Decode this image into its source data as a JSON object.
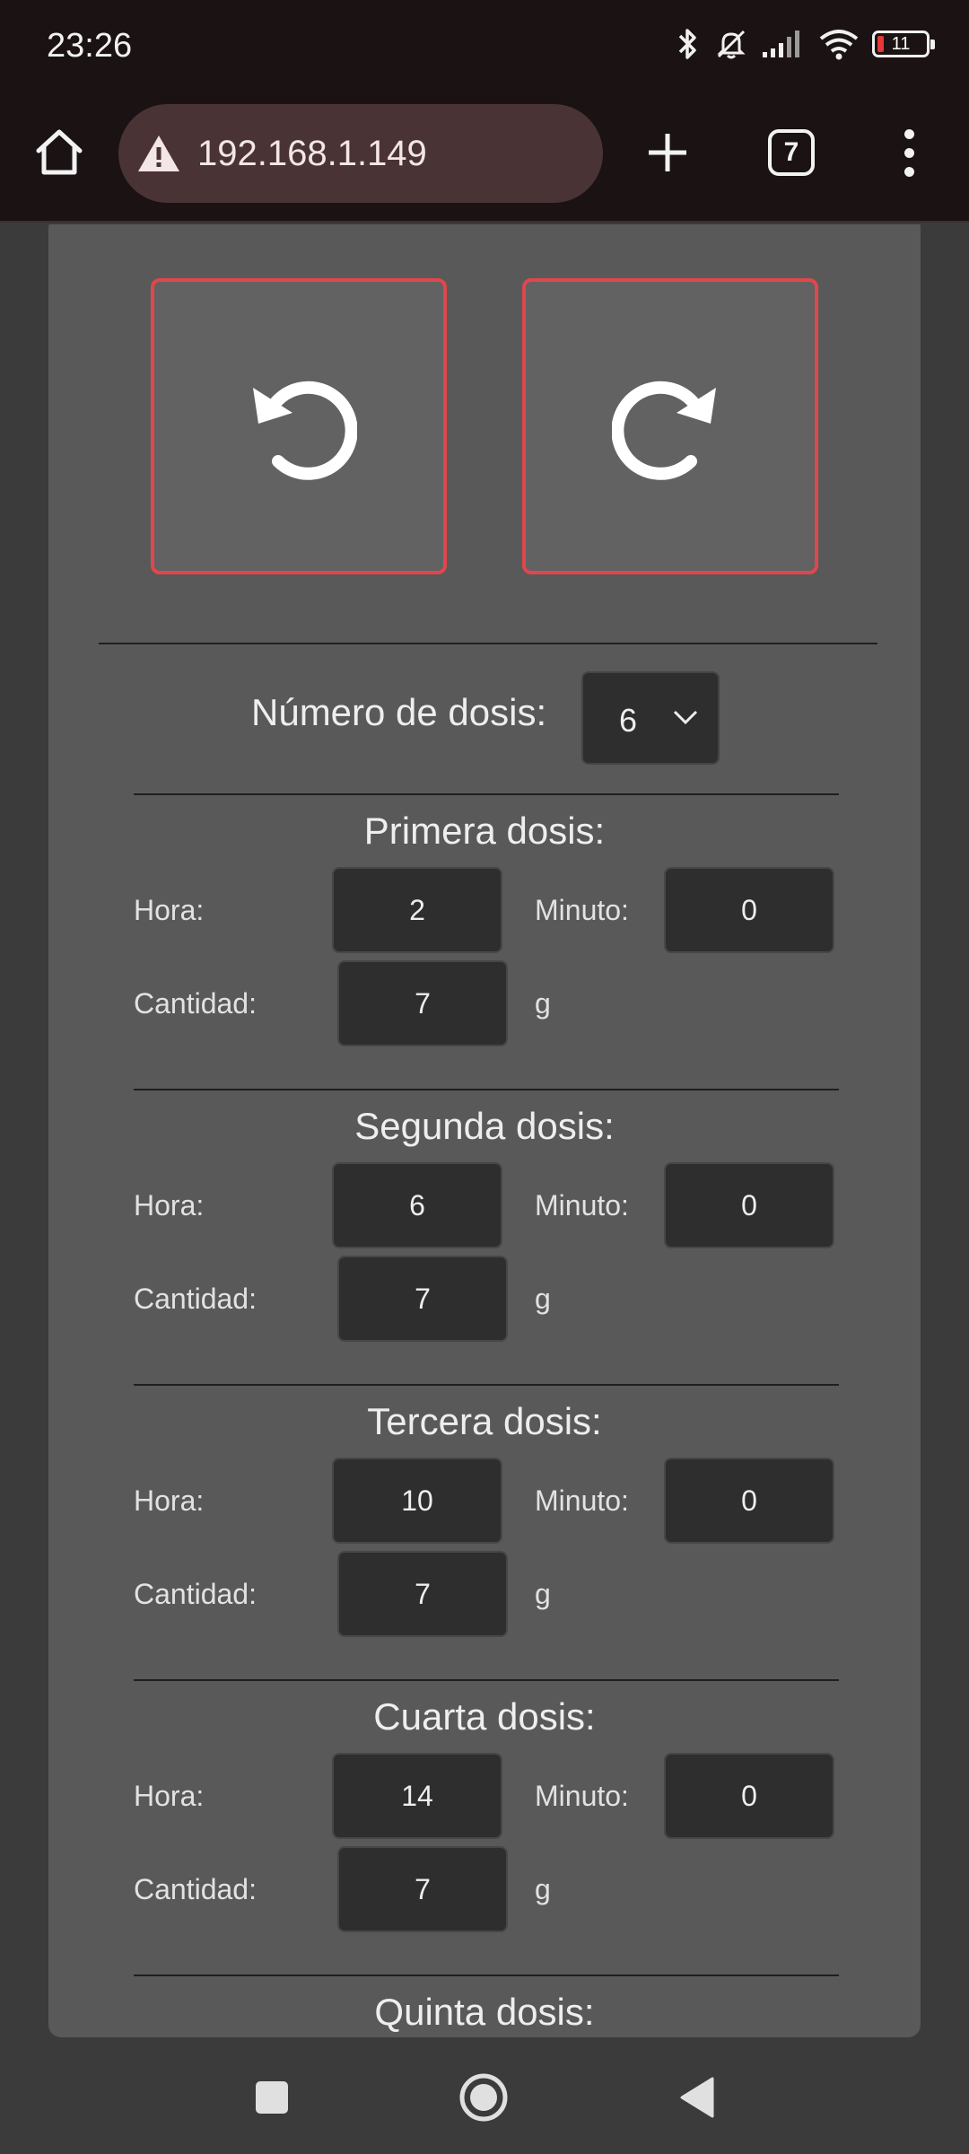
{
  "status_bar": {
    "time": "23:26",
    "battery": "11"
  },
  "browser": {
    "url": "192.168.1.149",
    "tab_count": "7"
  },
  "controls": {
    "rotate_left_icon": "rotate-ccw-icon",
    "rotate_right_icon": "rotate-cw-icon"
  },
  "dose_count": {
    "label": "Número de dosis:",
    "value": "6"
  },
  "labels": {
    "hora": "Hora:",
    "minuto": "Minuto:",
    "cantidad": "Cantidad:",
    "unit": "g"
  },
  "doses": [
    {
      "title": "Primera dosis:",
      "hora": "2",
      "minuto": "0",
      "cantidad": "7"
    },
    {
      "title": "Segunda dosis:",
      "hora": "6",
      "minuto": "0",
      "cantidad": "7"
    },
    {
      "title": "Tercera dosis:",
      "hora": "10",
      "minuto": "0",
      "cantidad": "7"
    },
    {
      "title": "Cuarta dosis:",
      "hora": "14",
      "minuto": "0",
      "cantidad": "7"
    },
    {
      "title": "Quinta dosis:"
    }
  ],
  "colors": {
    "accent_border": "#e0474c",
    "card": "#595959",
    "input_bg": "#2e2e2e",
    "chrome": "#1b1214"
  }
}
